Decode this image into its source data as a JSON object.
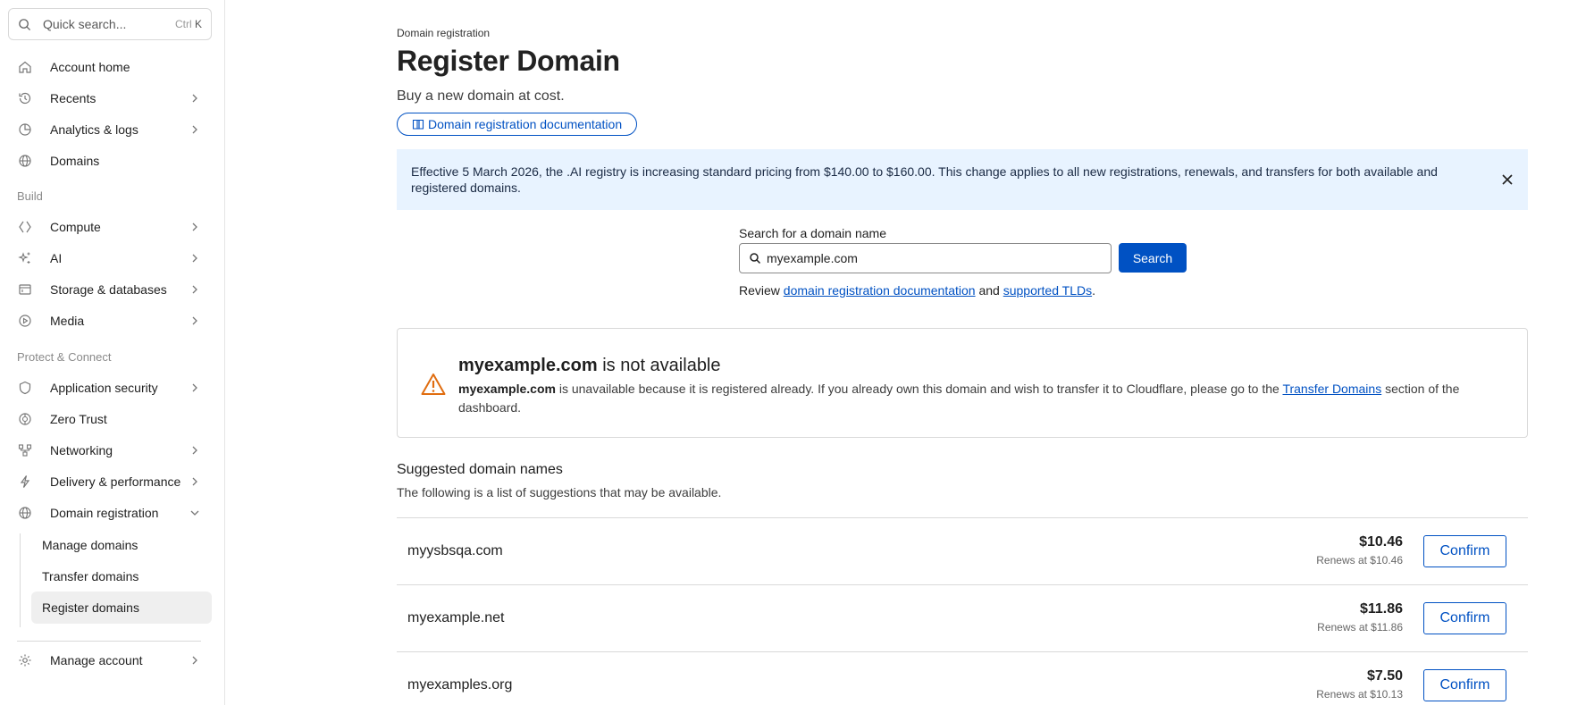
{
  "sidebar": {
    "search_placeholder": "Quick search...",
    "shortcut_prefix": "Ctrl",
    "shortcut_key": "K",
    "items": [
      {
        "label": "Account home",
        "icon": "home-icon"
      },
      {
        "label": "Recents",
        "icon": "history-icon"
      },
      {
        "label": "Analytics & logs",
        "icon": "chart-icon"
      },
      {
        "label": "Domains",
        "icon": "globe-icon"
      }
    ],
    "build_title": "Build",
    "build_items": [
      {
        "label": "Compute",
        "icon": "compute-icon"
      },
      {
        "label": "AI",
        "icon": "sparkle-icon"
      },
      {
        "label": "Storage & databases",
        "icon": "storage-icon"
      },
      {
        "label": "Media",
        "icon": "media-icon"
      }
    ],
    "protect_title": "Protect & Connect",
    "protect_items": [
      {
        "label": "Application security",
        "icon": "shield-icon"
      },
      {
        "label": "Zero Trust",
        "icon": "zero-trust-icon"
      },
      {
        "label": "Networking",
        "icon": "network-icon"
      },
      {
        "label": "Delivery & performance",
        "icon": "bolt-icon"
      },
      {
        "label": "Domain registration",
        "icon": "globe-icon"
      }
    ],
    "sub_items": [
      "Manage domains",
      "Transfer domains",
      "Register domains"
    ],
    "manage_account": "Manage account"
  },
  "main": {
    "breadcrumb": "Domain registration",
    "title": "Register Domain",
    "subtitle": "Buy a new domain at cost.",
    "doc_link": "Domain registration documentation",
    "banner": "Effective 5 March 2026, the .AI registry is increasing standard pricing from $140.00 to $160.00. This change applies to all new registrations, renewals, and transfers for both available and registered domains.",
    "search_label": "Search for a domain name",
    "search_value": "myexample.com",
    "search_button": "Search",
    "review_prefix": "Review",
    "review_link1": "domain registration documentation",
    "review_and": "and",
    "review_link2": "supported TLDs",
    "review_suffix": ".",
    "alert": {
      "domain": "myexample.com",
      "head_rest": " is not available",
      "body_domain": "myexample.com",
      "body_text": " is unavailable because it is registered already. If you already own this domain and wish to transfer it to Cloudflare, please go to the ",
      "body_link": "Transfer Domains",
      "body_end": " section of the dashboard."
    },
    "suggestions_title": "Suggested domain names",
    "suggestions_sub": "The following is a list of suggestions that may be available.",
    "suggestions": [
      {
        "name": "myysbsqa.com",
        "price": "$10.46",
        "renew": "Renews at $10.46",
        "button": "Confirm"
      },
      {
        "name": "myexample.net",
        "price": "$11.86",
        "renew": "Renews at $11.86",
        "button": "Confirm"
      },
      {
        "name": "myexamples.org",
        "price": "$7.50",
        "renew": "Renews at $10.13",
        "button": "Confirm"
      }
    ]
  },
  "colors": {
    "accent": "#0051c3",
    "banner_bg": "#e8f3ff",
    "warning": "#e06d10",
    "active_nav": "#efefef"
  }
}
